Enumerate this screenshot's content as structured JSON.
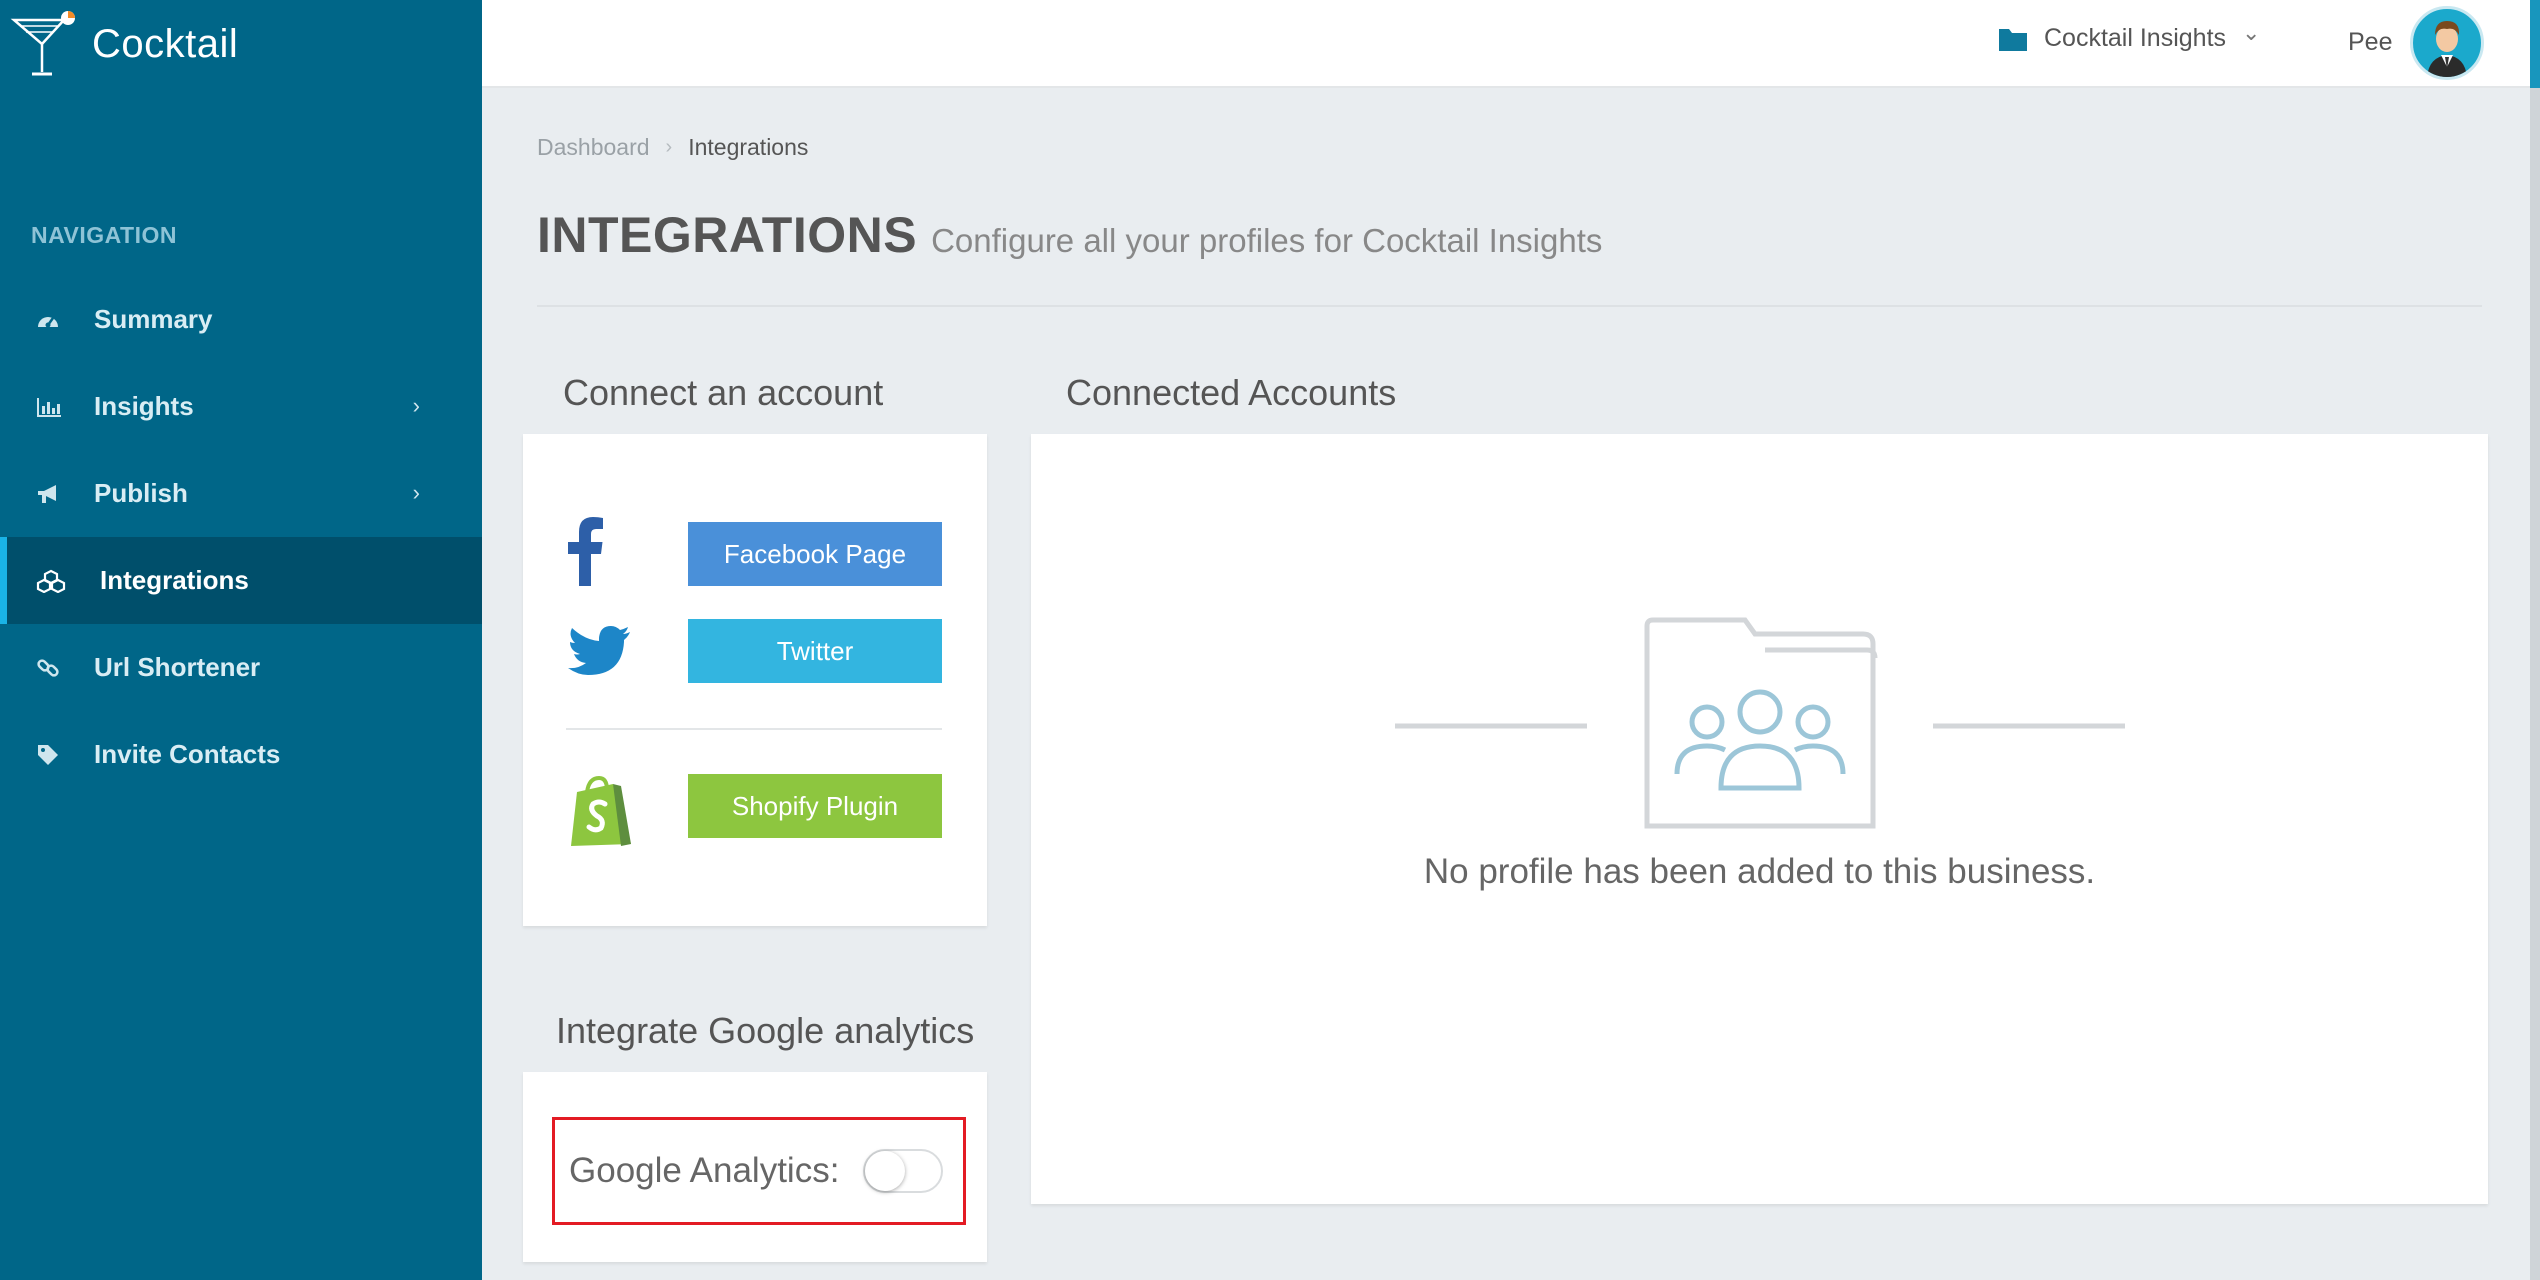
{
  "brand": {
    "name": "Cocktail"
  },
  "sidebar": {
    "heading": "NAVIGATION",
    "items": [
      {
        "label": "Summary",
        "icon": "dashboard-icon",
        "has_children": false,
        "active": false
      },
      {
        "label": "Insights",
        "icon": "bar-chart-icon",
        "has_children": true,
        "active": false
      },
      {
        "label": "Publish",
        "icon": "megaphone-icon",
        "has_children": true,
        "active": false
      },
      {
        "label": "Integrations",
        "icon": "cubes-icon",
        "has_children": false,
        "active": true
      },
      {
        "label": "Url Shortener",
        "icon": "link-icon",
        "has_children": false,
        "active": false
      },
      {
        "label": "Invite Contacts",
        "icon": "tag-icon",
        "has_children": false,
        "active": false
      }
    ],
    "chevron": "›"
  },
  "topbar": {
    "business": "Cocktail Insights",
    "business_chevron": "⌄",
    "user": "Pee"
  },
  "breadcrumb": {
    "first": "Dashboard",
    "separator": "›",
    "current": "Integrations"
  },
  "page": {
    "title": "INTEGRATIONS",
    "subtitle": "Configure all your profiles for Cocktail Insights"
  },
  "connect": {
    "title": "Connect an account",
    "facebook": "Facebook Page",
    "twitter": "Twitter",
    "shopify": "Shopify Plugin"
  },
  "google": {
    "title": "Integrate Google analytics",
    "label": "Google Analytics:",
    "enabled": false
  },
  "accounts": {
    "title": "Connected Accounts",
    "empty": "No profile has been added to this business."
  },
  "colors": {
    "sidebar": "#006688",
    "sidebar_active": "#004f6b",
    "facebook": "#4a90d9",
    "twitter": "#33b5e0",
    "shopify": "#8dc63f",
    "highlight": "#e31b23"
  }
}
